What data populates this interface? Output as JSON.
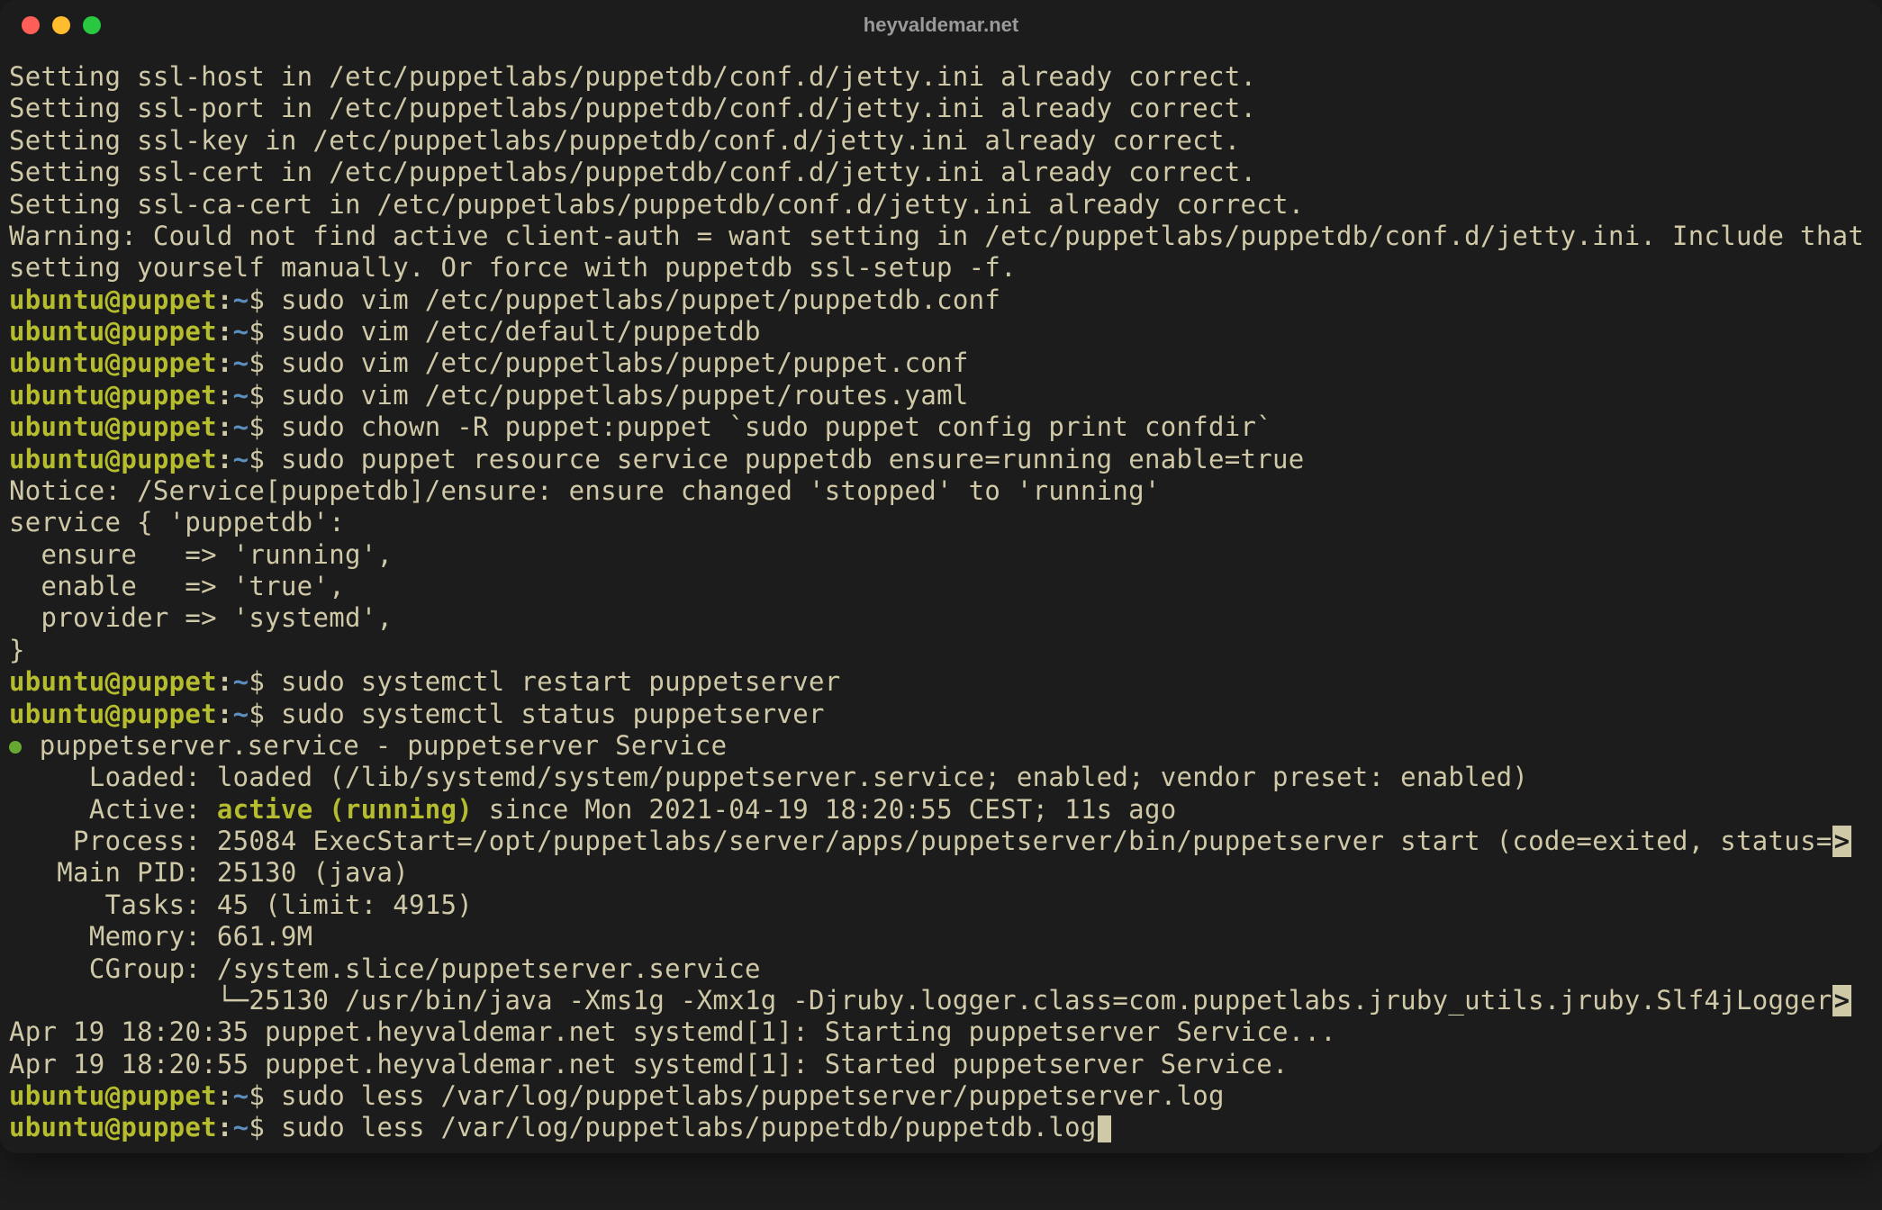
{
  "window": {
    "title": "heyvaldemar.net"
  },
  "prompt": {
    "user_host": "ubuntu@puppet",
    "sep": ":",
    "path": "~",
    "end": "$ "
  },
  "lines": [
    {
      "type": "out",
      "text": "Setting ssl-host in /etc/puppetlabs/puppetdb/conf.d/jetty.ini already correct."
    },
    {
      "type": "out",
      "text": "Setting ssl-port in /etc/puppetlabs/puppetdb/conf.d/jetty.ini already correct."
    },
    {
      "type": "out",
      "text": "Setting ssl-key in /etc/puppetlabs/puppetdb/conf.d/jetty.ini already correct."
    },
    {
      "type": "out",
      "text": "Setting ssl-cert in /etc/puppetlabs/puppetdb/conf.d/jetty.ini already correct."
    },
    {
      "type": "out",
      "text": "Setting ssl-ca-cert in /etc/puppetlabs/puppetdb/conf.d/jetty.ini already correct."
    },
    {
      "type": "out",
      "text": "Warning: Could not find active client-auth = want setting in /etc/puppetlabs/puppetdb/conf.d/jetty.ini. Include that setting yourself manually. Or force with puppetdb ssl-setup -f."
    },
    {
      "type": "cmd",
      "text": "sudo vim /etc/puppetlabs/puppet/puppetdb.conf"
    },
    {
      "type": "cmd",
      "text": "sudo vim /etc/default/puppetdb"
    },
    {
      "type": "cmd",
      "text": "sudo vim /etc/puppetlabs/puppet/puppet.conf"
    },
    {
      "type": "cmd",
      "text": "sudo vim /etc/puppetlabs/puppet/routes.yaml"
    },
    {
      "type": "cmd",
      "text": "sudo chown -R puppet:puppet `sudo puppet config print confdir`"
    },
    {
      "type": "cmd",
      "text": "sudo puppet resource service puppetdb ensure=running enable=true"
    },
    {
      "type": "out",
      "text": "Notice: /Service[puppetdb]/ensure: ensure changed 'stopped' to 'running'"
    },
    {
      "type": "out",
      "text": "service { 'puppetdb':"
    },
    {
      "type": "out",
      "text": "  ensure   => 'running',"
    },
    {
      "type": "out",
      "text": "  enable   => 'true',"
    },
    {
      "type": "out",
      "text": "  provider => 'systemd',"
    },
    {
      "type": "out",
      "text": "}"
    },
    {
      "type": "cmd",
      "text": "sudo systemctl restart puppetserver"
    },
    {
      "type": "cmd",
      "text": "sudo systemctl status puppetserver"
    },
    {
      "type": "status-head",
      "text": " puppetserver.service - puppetserver Service"
    },
    {
      "type": "out",
      "text": "     Loaded: loaded (/lib/systemd/system/puppetserver.service; enabled; vendor preset: enabled)"
    },
    {
      "type": "status-active",
      "prefix": "     Active: ",
      "active": "active (running)",
      "suffix": " since Mon 2021-04-19 18:20:55 CEST; 11s ago"
    },
    {
      "type": "trunc",
      "text": "    Process: 25084 ExecStart=/opt/puppetlabs/server/apps/puppetserver/bin/puppetserver start (code=exited, status=",
      "trunc": ">"
    },
    {
      "type": "out",
      "text": "   Main PID: 25130 (java)"
    },
    {
      "type": "out",
      "text": "      Tasks: 45 (limit: 4915)"
    },
    {
      "type": "out",
      "text": "     Memory: 661.9M"
    },
    {
      "type": "out",
      "text": "     CGroup: /system.slice/puppetserver.service"
    },
    {
      "type": "tree-trunc",
      "prefix": "             ",
      "tree": "└─",
      "text": "25130 /usr/bin/java -Xms1g -Xmx1g -Djruby.logger.class=com.puppetlabs.jruby_utils.jruby.Slf4jLogger",
      "trunc": ">"
    },
    {
      "type": "out",
      "text": ""
    },
    {
      "type": "out",
      "text": "Apr 19 18:20:35 puppet.heyvaldemar.net systemd[1]: Starting puppetserver Service..."
    },
    {
      "type": "out",
      "text": "Apr 19 18:20:55 puppet.heyvaldemar.net systemd[1]: Started puppetserver Service."
    },
    {
      "type": "cmd",
      "text": "sudo less /var/log/puppetlabs/puppetserver/puppetserver.log"
    },
    {
      "type": "cmd-cursor",
      "text": "sudo less /var/log/puppetlabs/puppetdb/puppetdb.log"
    }
  ]
}
